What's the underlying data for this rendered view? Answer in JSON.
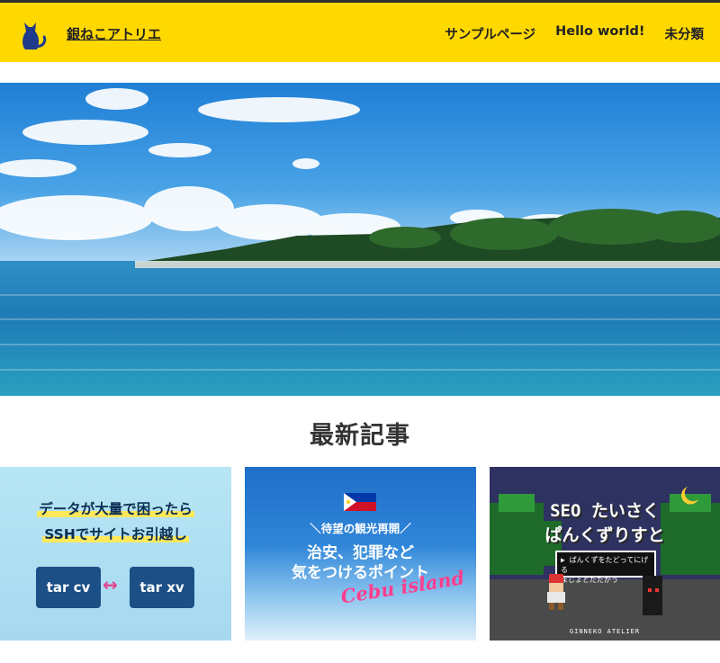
{
  "header": {
    "site_title": "銀ねこアトリエ",
    "logo_icon": "cat-icon",
    "bg_color": "#ffd800",
    "nav": [
      {
        "label": "サンプルページ"
      },
      {
        "label": "Hello world!"
      },
      {
        "label": "未分類"
      }
    ]
  },
  "hero": {
    "image": "tropical-sea-island-photo"
  },
  "latest": {
    "heading": "最新記事",
    "cards": [
      {
        "line1": "データが大量で困ったら",
        "line2": "SSHでサイトお引越し",
        "box_left": "tar cv",
        "box_right": "tar xv",
        "arrow": "↔"
      },
      {
        "flag_icon": "philippines-flag-icon",
        "sub": "＼待望の観光再開／",
        "main1": "治安、犯罪など",
        "main2": "気をつけるポイント",
        "script": "Cebu island"
      },
      {
        "title1": "SEO たいさく",
        "title2": "ぱんくずりすと",
        "box_line1": "▶ ぱんくずをたどってにげる",
        "box_line2": "まじょとたたかう",
        "footer": "GINNEKO ATELIER"
      }
    ]
  }
}
